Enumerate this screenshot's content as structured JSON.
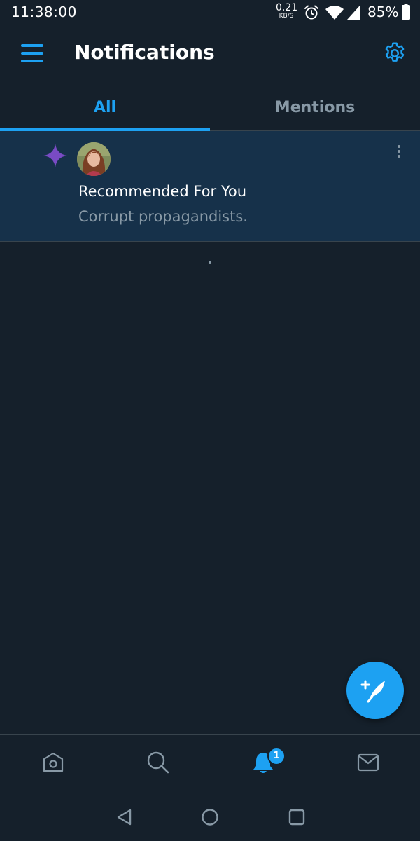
{
  "status_bar": {
    "time": "11:38:00",
    "net_speed_value": "0.21",
    "net_speed_unit": "KB/S",
    "battery": "85%",
    "icons": [
      "alarm-icon",
      "wifi-icon",
      "cell-signal-icon",
      "battery-icon"
    ]
  },
  "header": {
    "title": "Notifications",
    "menu_icon": "hamburger-menu-icon",
    "settings_icon": "gear-icon"
  },
  "tabs": [
    {
      "label": "All",
      "selected": true
    },
    {
      "label": "Mentions",
      "selected": false
    }
  ],
  "notifications": [
    {
      "icon": "sparkle-icon",
      "title": "Recommended For You",
      "subtitle": "Corrupt propagandists.",
      "more_icon": "more-vertical-icon"
    }
  ],
  "fab": {
    "icon": "compose-tweet-icon"
  },
  "bottom_nav": {
    "items": [
      {
        "icon": "home-icon",
        "active": false
      },
      {
        "icon": "search-icon",
        "active": false
      },
      {
        "icon": "notifications-bell-icon",
        "active": true,
        "badge": "1"
      },
      {
        "icon": "messages-envelope-icon",
        "active": false
      }
    ]
  },
  "system_nav": {
    "icons": [
      "back-icon",
      "home-circle-icon",
      "recents-icon"
    ]
  },
  "colors": {
    "background": "#15202b",
    "accent": "#1da1f2",
    "highlight_row": "#16314a",
    "muted_text": "#8899a6",
    "divider": "#38444d",
    "sparkle": "#794bc4"
  }
}
